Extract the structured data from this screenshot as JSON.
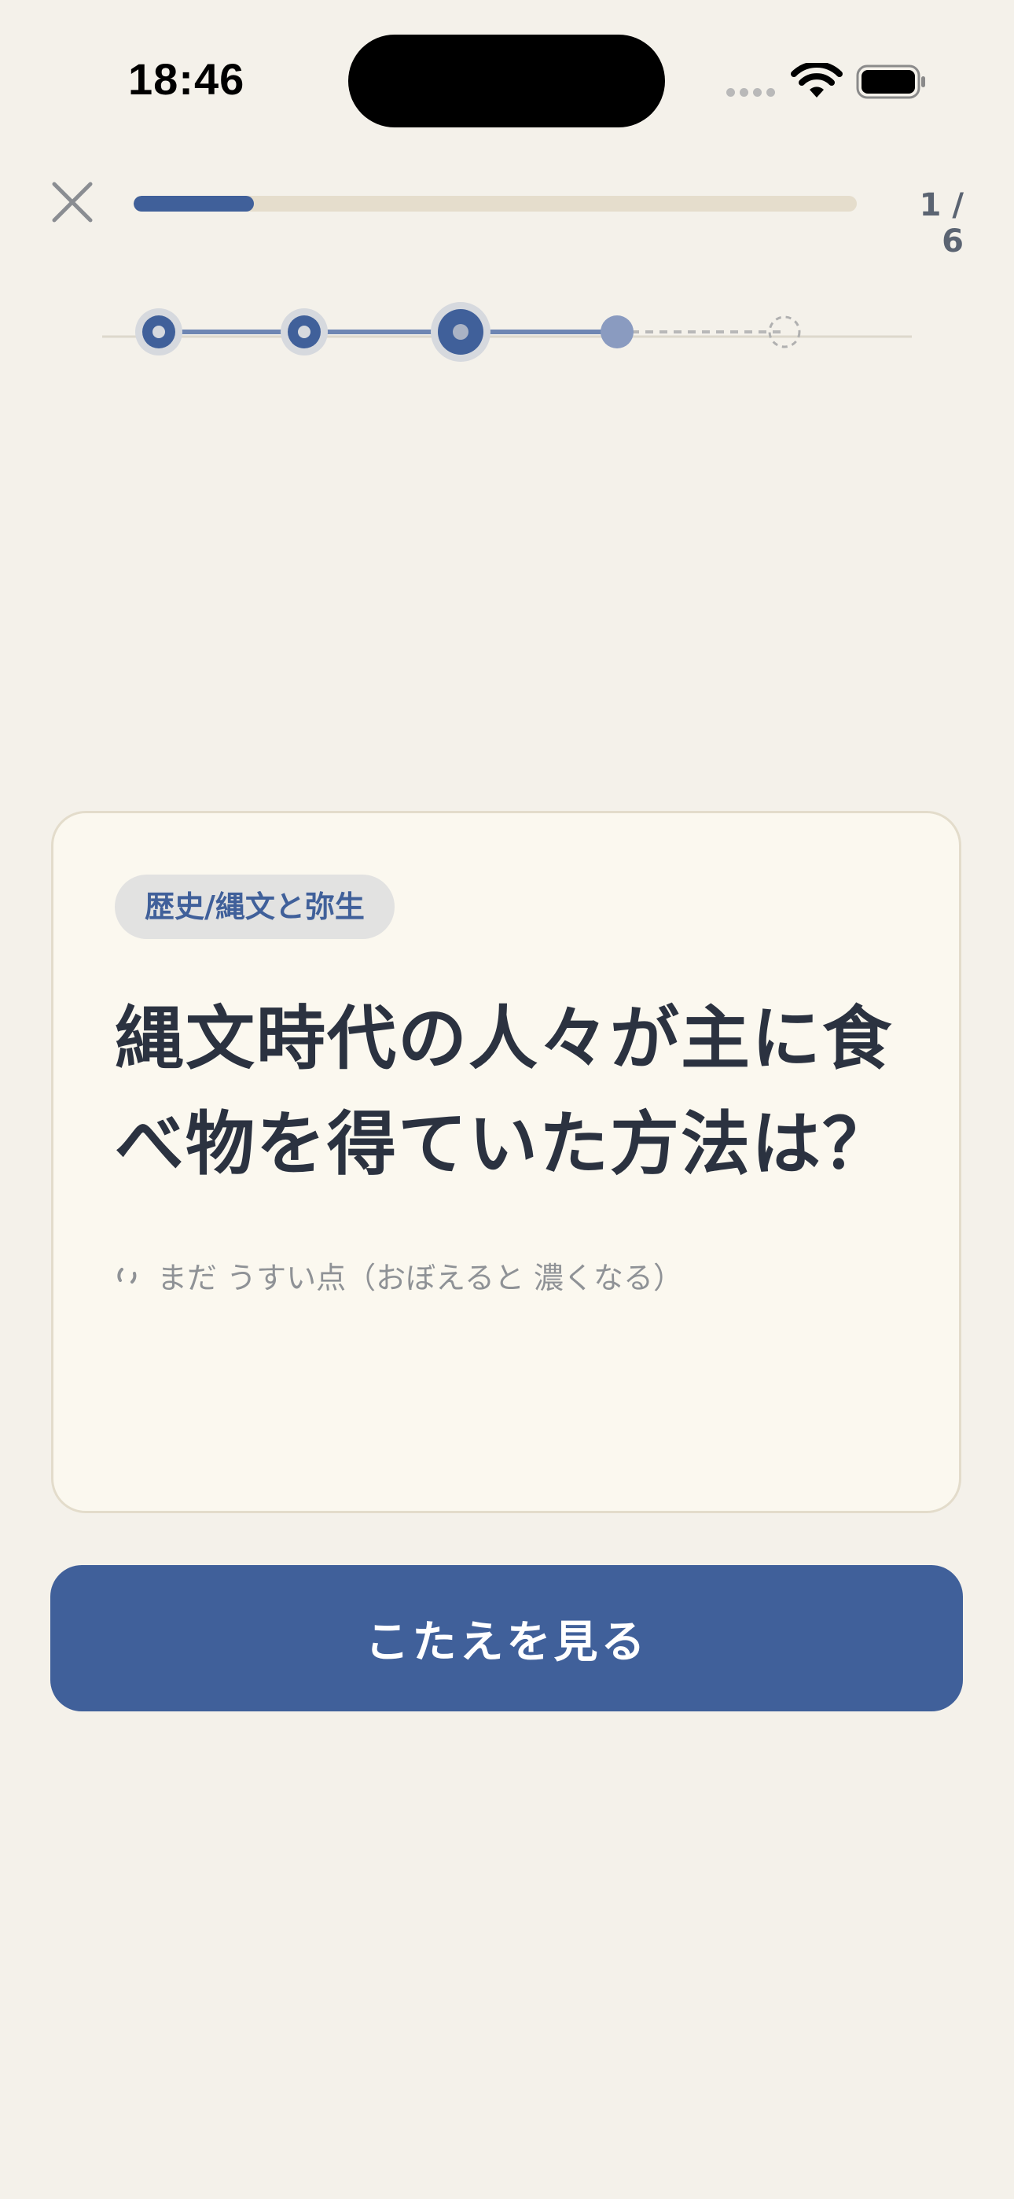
{
  "status_bar": {
    "time": "18:46"
  },
  "header": {
    "close_icon": "close-x-icon",
    "progress_fraction": 0.166,
    "progress_text": "1 / 6"
  },
  "path": {
    "steps": [
      "done",
      "done",
      "current",
      "next",
      "locked"
    ]
  },
  "card": {
    "tag": "歴史/縄文と弥生",
    "question": "縄文時代の人々が主に食べ物を得ていた方法は？",
    "status_icon": "faint-arc-icon",
    "status_text": "まだ うすい点（おぼえると 濃くなる）"
  },
  "action": {
    "reveal_label": "こたえを見る"
  },
  "colors": {
    "accent": "#40609a",
    "background": "#f4f1ea",
    "card": "#fbf8ef",
    "text": "#2b3240"
  }
}
